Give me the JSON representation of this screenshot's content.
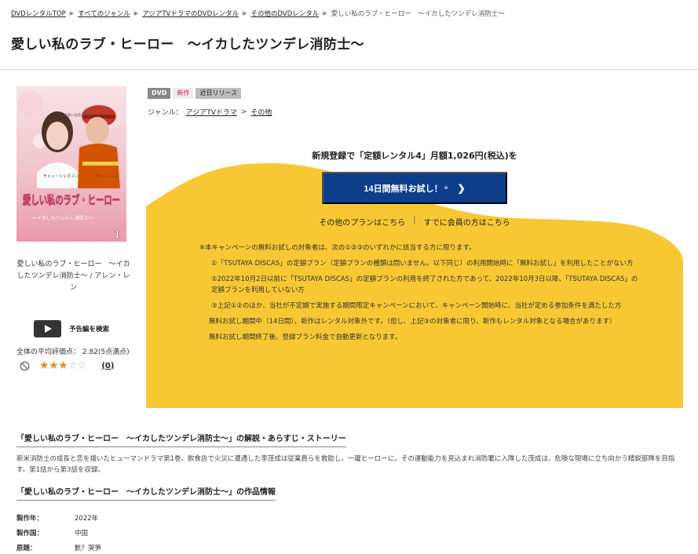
{
  "breadcrumb": {
    "items": [
      "DVDレンタルTOP",
      "すべてのジャンル",
      "アジアTVドラマのDVDレンタル",
      "その他のDVDレンタル"
    ],
    "current": "愛しい私のラブ・ヒーロー　〜イカしたツンデレ消防士〜"
  },
  "title": "愛しい私のラブ・ヒーロー　〜イカしたツンデレ消防士〜",
  "cover": {
    "caption": "愛しい私のラブ・ヒーロー　〜イカしたツンデレ消防士〜 / アレン・レン",
    "title_art": "愛しい私のラブ・ヒーロー",
    "subtitle_art": "〜イカしたツンデレ消防士〜",
    "actor_left": "チェン・シャオユン",
    "actor_right": "アレン・レン",
    "volume": "1",
    "tagline": "出会いは恋の始まり"
  },
  "trailer": {
    "label": "予告編を検索"
  },
  "rating": {
    "summary": "全体の平均評価点：  2.82(5点満点)",
    "value": 2.82,
    "max": 5,
    "filled": 3,
    "reviews": "(0)"
  },
  "badges": {
    "dvd": "DVD",
    "new": "新作",
    "soon": "近日リリース"
  },
  "genre": {
    "label": "ジャンル：",
    "items": [
      "アジアTVドラマ",
      "その他"
    ]
  },
  "promo": {
    "headline": "新規登録で「定額レンタル4」月額1,026円(税込)を",
    "button": "14日間無料お試し！",
    "button_note": "※",
    "plan_link": "その他のプランはこちら",
    "member_link": "すでに会員の方はこちら",
    "color_bg": "#f8c834",
    "color_button": "#0d3e8a"
  },
  "notes": {
    "intro": "※本キャンペーンの無料お試しの対象者は、次の①②③のいずれかに該当する方に限ります。",
    "n1": "①「TSUTAYA DISCAS」の定額プラン（定額プランの種類は問いません。以下同じ）の利用開始時に「無料お試し」を利用したことがない方",
    "n2": "②2022年10月2日以前に「TSUTAYA DISCAS」の定額プランの利用を終了された方であって、2022年10月3日以降、「TSUTAYA DISCAS」の定額プランを利用していない方",
    "n3": "③上記①②のほか、当社が不定期で実施する期間限定キャンペーンにおいて、キャンペーン開始時に、当社が定める参加条件を満たした方",
    "p1": "無料お試し期間中（14日間）、新作はレンタル対象外です。（但し、上記③の対象者に限り、新作もレンタル対象となる場合があります）",
    "p2": "無料お試し期間終了後、登録プラン料金で自動更新となります。"
  },
  "synopsis": {
    "heading": "「愛しい私のラブ・ヒーロー　〜イカしたツンデレ消防士〜」の解説・あらすじ・ストーリー",
    "text": "新米消防士の成長と恋を描いたヒューマンドラマ第1巻。飲食店で火災に遭遇した李茂成は従業員らを救助し、一躍ヒーローに。その運動能力を見込まれ消防署に入隊した茂成は、危険な現場に立ち向かう精鋭部隊を目指す。第1話から第3話を収録。"
  },
  "info": {
    "heading": "「愛しい私のラブ・ヒーロー　〜イカしたツンデレ消防士〜」の作品情報",
    "rows": [
      {
        "k": "製作年：",
        "v": "2022年"
      },
      {
        "k": "製作国：",
        "v": "中国"
      },
      {
        "k": "原題：",
        "v": "骯？哭笋"
      }
    ]
  }
}
